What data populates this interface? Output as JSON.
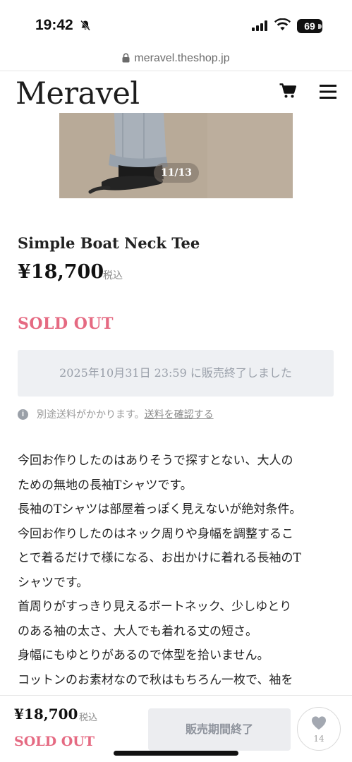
{
  "status_bar": {
    "time": "19:42",
    "battery": "69"
  },
  "browser": {
    "url": "meravel.theshop.jp"
  },
  "header": {
    "logo": "Meravel"
  },
  "gallery": {
    "counter": "11/13"
  },
  "product": {
    "title": "Simple Boat Neck Tee",
    "price": "¥18,700",
    "tax_label": "税込",
    "status": "SOLD OUT",
    "sale_notice": "2025年10月31日 23:59 に販売終了しました",
    "shipping_note": "別途送料がかかります。",
    "shipping_link": "送料を確認する",
    "description_lines": [
      "今回お作りしたのはありそうで探すとない、大人の",
      "ための無地の長袖Tシャツです。",
      "長袖のTシャツは部屋着っぽく見えないが絶対条件。",
      "今回お作りしたのはネック周りや身幅を調整するこ",
      "とで着るだけで様になる、お出かけに着れる長袖のT",
      "シャツです。",
      "首周りがすっきり見えるボートネック、少しゆとり",
      "のある袖の太さ、大人でも着れる丈の短さ。",
      "身幅にもゆとりがあるので体型を拾いません。",
      "コットンのお素材なので秋はもちろん一枚で、袖を"
    ]
  },
  "bottom_bar": {
    "price": "¥18,700",
    "tax_label": "税込",
    "status": "SOLD OUT",
    "button_label": "販売期間終了",
    "favorite_count": "14"
  },
  "colors": {
    "accent_soldout": "#e56a82",
    "notice_bg": "#eef0f3"
  }
}
